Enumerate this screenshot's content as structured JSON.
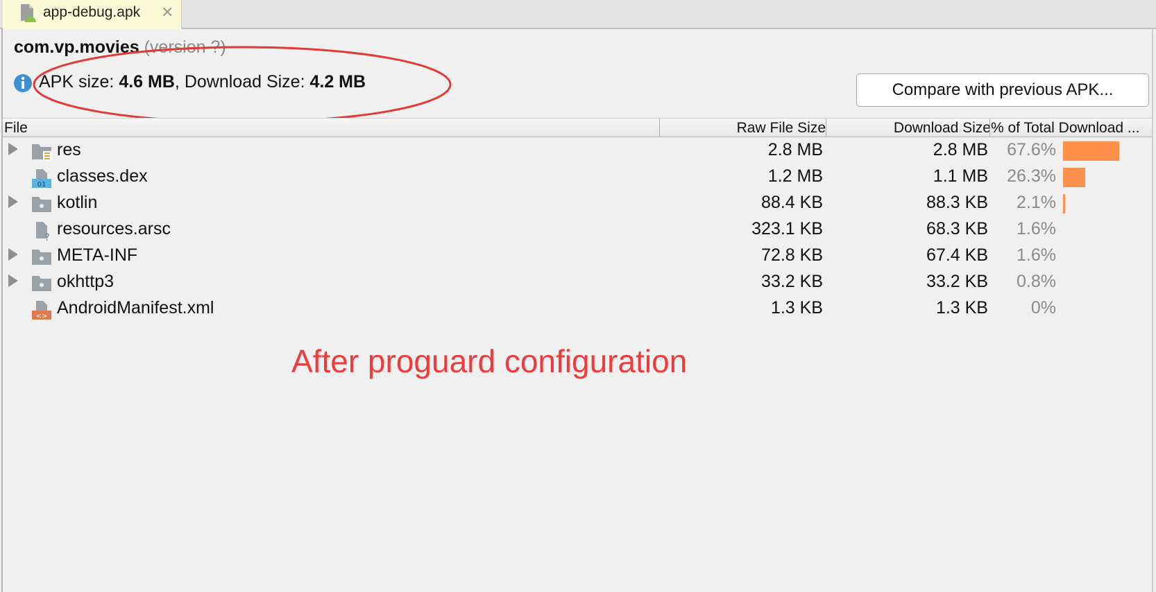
{
  "tab": {
    "label": "app-debug.apk",
    "close": "✕",
    "icon": "apk-file-icon"
  },
  "header": {
    "package": "com.vp.movies",
    "version": "(version ?)",
    "apk_size_label": "APK size: ",
    "apk_size": "4.6 MB",
    "sep": ", ",
    "download_size_label": "Download Size: ",
    "download_size": "4.2 MB",
    "compare_button": "Compare with previous APK..."
  },
  "table": {
    "columns": [
      "File",
      "Raw File Size",
      "Download Size",
      "% of Total Download ..."
    ],
    "rows": [
      {
        "name": "res",
        "raw": "2.8 MB",
        "download": "2.8 MB",
        "percent": "67.6%",
        "share": 0.676,
        "expandable": true,
        "icon": "res-folder-icon"
      },
      {
        "name": "classes.dex",
        "raw": "1.2 MB",
        "download": "1.1 MB",
        "percent": "26.3%",
        "share": 0.263,
        "expandable": false,
        "icon": "dex-file-icon"
      },
      {
        "name": "kotlin",
        "raw": "88.4 KB",
        "download": "88.3 KB",
        "percent": "2.1%",
        "share": 0.021,
        "expandable": true,
        "icon": "folder-icon"
      },
      {
        "name": "resources.arsc",
        "raw": "323.1 KB",
        "download": "68.3 KB",
        "percent": "1.6%",
        "share": 0.016,
        "expandable": false,
        "icon": "unknown-file-icon"
      },
      {
        "name": "META-INF",
        "raw": "72.8 KB",
        "download": "67.4 KB",
        "percent": "1.6%",
        "share": 0.016,
        "expandable": true,
        "icon": "folder-icon"
      },
      {
        "name": "okhttp3",
        "raw": "33.2 KB",
        "download": "33.2 KB",
        "percent": "0.8%",
        "share": 0.008,
        "expandable": true,
        "icon": "folder-icon"
      },
      {
        "name": "AndroidManifest.xml",
        "raw": "1.3 KB",
        "download": "1.3 KB",
        "percent": "0%",
        "share": 0.0,
        "expandable": false,
        "icon": "xml-file-icon"
      }
    ]
  },
  "annotation": {
    "caption": "After proguard configuration",
    "color": "#ee3b3b"
  },
  "colors": {
    "bar": "#ff914d",
    "tab_bg": "#fafad6"
  }
}
